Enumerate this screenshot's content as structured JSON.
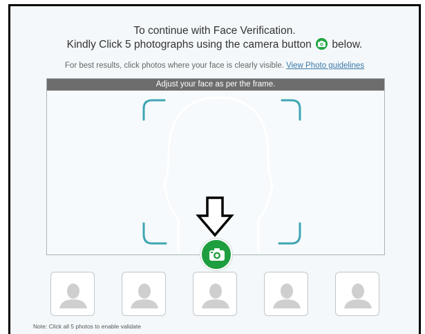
{
  "header": {
    "line1": "To continue with Face Verification.",
    "line2_before": "Kindly Click 5 photographs using the camera button",
    "line2_after": "below."
  },
  "hint": {
    "text": "For best results, click photos where your face is clearly visible.",
    "link": "View Photo guidelines"
  },
  "capture": {
    "banner": "Adjust your face as per the frame."
  },
  "thumbnails": [
    {
      "state": "empty"
    },
    {
      "state": "empty"
    },
    {
      "state": "empty"
    },
    {
      "state": "empty"
    },
    {
      "state": "empty"
    }
  ],
  "note": "Note: Click all 5 photos to enable validate",
  "colors": {
    "accent_green": "#1f9e3f",
    "frame_corner": "#3fa5b3",
    "banner_bg": "#6d6d6d",
    "link": "#3a78a8"
  },
  "icons": {
    "camera_button": "camera-icon",
    "thumbnail_placeholder": "person-silhouette-icon",
    "pointer": "down-arrow-icon"
  }
}
